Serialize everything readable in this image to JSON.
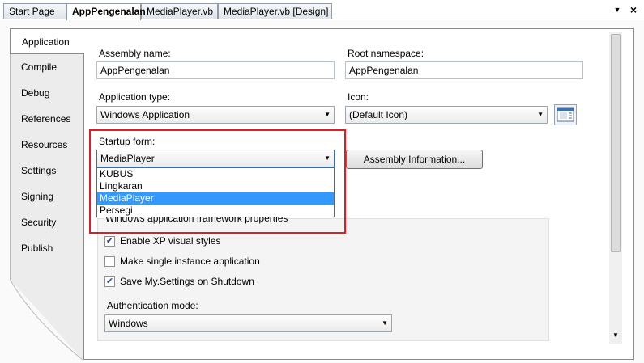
{
  "doc_tabs": {
    "items": [
      "Start Page",
      "AppPengenalan",
      "MediaPlayer.vb",
      "MediaPlayer.vb [Design]"
    ],
    "active_index": 1
  },
  "side_tabs": {
    "items": [
      "Application",
      "Compile",
      "Debug",
      "References",
      "Resources",
      "Settings",
      "Signing",
      "Security",
      "Publish"
    ],
    "active_index": 0
  },
  "form": {
    "assembly_name_label": "Assembly name:",
    "assembly_name_value": "AppPengenalan",
    "root_namespace_label": "Root namespace:",
    "root_namespace_value": "AppPengenalan",
    "application_type_label": "Application type:",
    "application_type_value": "Windows Application",
    "icon_label": "Icon:",
    "icon_value": "(Default Icon)",
    "startup_form_label": "Startup form:",
    "startup_form_value": "MediaPlayer",
    "startup_form_options": [
      "KUBUS",
      "Lingkaran",
      "MediaPlayer",
      "Persegi"
    ],
    "startup_form_selected_index": 2,
    "assembly_info_button": "Assembly Information...",
    "framework_group_label": "Windows application framework properties",
    "enable_xp_label": "Enable XP visual styles",
    "enable_xp_checked": true,
    "single_instance_label": "Make single instance application",
    "single_instance_checked": false,
    "save_settings_label": "Save My.Settings on Shutdown",
    "save_settings_checked": true,
    "auth_mode_label": "Authentication mode:",
    "auth_mode_value": "Windows"
  },
  "colors": {
    "highlight": "#3399ff",
    "annotation_border": "#e11b22"
  }
}
